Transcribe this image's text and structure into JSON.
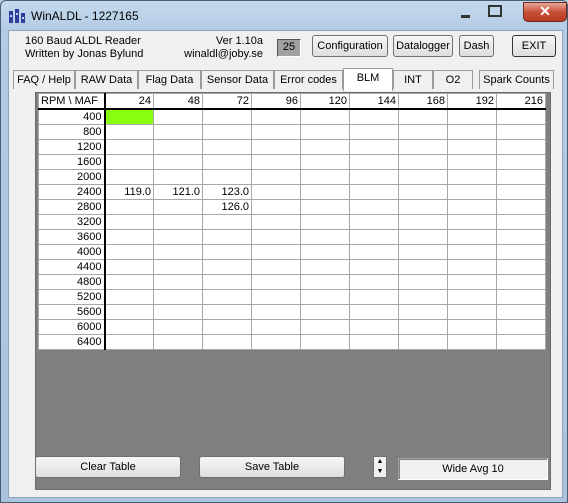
{
  "window": {
    "title": "WinALDL - 1227165",
    "close_label": "✕"
  },
  "header": {
    "line1": "160 Baud ALDL Reader",
    "line2": "Written by Jonas Bylund",
    "version": "Ver 1.10a",
    "email": "winaldl@joby.se",
    "counter": "25"
  },
  "buttons": {
    "configuration": "Configuration",
    "datalogger": "Datalogger",
    "dash": "Dash",
    "exit": "EXIT",
    "clear_table": "Clear Table",
    "save_table": "Save Table"
  },
  "tabs": [
    "FAQ / Help",
    "RAW Data",
    "Flag Data",
    "Sensor Data",
    "Error codes",
    "BLM",
    "INT",
    "O2",
    "Spark Counts"
  ],
  "active_tab": "BLM",
  "table": {
    "corner": "RPM \\ MAF",
    "columns": [
      "24",
      "48",
      "72",
      "96",
      "120",
      "144",
      "168",
      "192",
      "216"
    ],
    "rows": [
      {
        "rpm": "400",
        "cells": [
          "",
          "",
          "",
          "",
          "",
          "",
          "",
          "",
          ""
        ]
      },
      {
        "rpm": "800",
        "cells": [
          "",
          "",
          "",
          "",
          "",
          "",
          "",
          "",
          ""
        ]
      },
      {
        "rpm": "1200",
        "cells": [
          "",
          "",
          "",
          "",
          "",
          "",
          "",
          "",
          ""
        ]
      },
      {
        "rpm": "1600",
        "cells": [
          "",
          "",
          "",
          "",
          "",
          "",
          "",
          "",
          ""
        ]
      },
      {
        "rpm": "2000",
        "cells": [
          "",
          "",
          "",
          "",
          "",
          "",
          "",
          "",
          ""
        ]
      },
      {
        "rpm": "2400",
        "cells": [
          "119.0",
          "121.0",
          "123.0",
          "",
          "",
          "",
          "",
          "",
          ""
        ]
      },
      {
        "rpm": "2800",
        "cells": [
          "",
          "",
          "126.0",
          "",
          "",
          "",
          "",
          "",
          ""
        ]
      },
      {
        "rpm": "3200",
        "cells": [
          "",
          "",
          "",
          "",
          "",
          "",
          "",
          "",
          ""
        ]
      },
      {
        "rpm": "3600",
        "cells": [
          "",
          "",
          "",
          "",
          "",
          "",
          "",
          "",
          ""
        ]
      },
      {
        "rpm": "4000",
        "cells": [
          "",
          "",
          "",
          "",
          "",
          "",
          "",
          "",
          ""
        ]
      },
      {
        "rpm": "4400",
        "cells": [
          "",
          "",
          "",
          "",
          "",
          "",
          "",
          "",
          ""
        ]
      },
      {
        "rpm": "4800",
        "cells": [
          "",
          "",
          "",
          "",
          "",
          "",
          "",
          "",
          ""
        ]
      },
      {
        "rpm": "5200",
        "cells": [
          "",
          "",
          "",
          "",
          "",
          "",
          "",
          "",
          ""
        ]
      },
      {
        "rpm": "5600",
        "cells": [
          "",
          "",
          "",
          "",
          "",
          "",
          "",
          "",
          ""
        ]
      },
      {
        "rpm": "6000",
        "cells": [
          "",
          "",
          "",
          "",
          "",
          "",
          "",
          "",
          ""
        ]
      },
      {
        "rpm": "6400",
        "cells": [
          "",
          "",
          "",
          "",
          "",
          "",
          "",
          "",
          ""
        ]
      }
    ],
    "highlight_color": "#88ff11",
    "highlight_cell": {
      "row": "400",
      "column": "24"
    }
  },
  "averaging": {
    "mode": "Wide Avg 10"
  }
}
